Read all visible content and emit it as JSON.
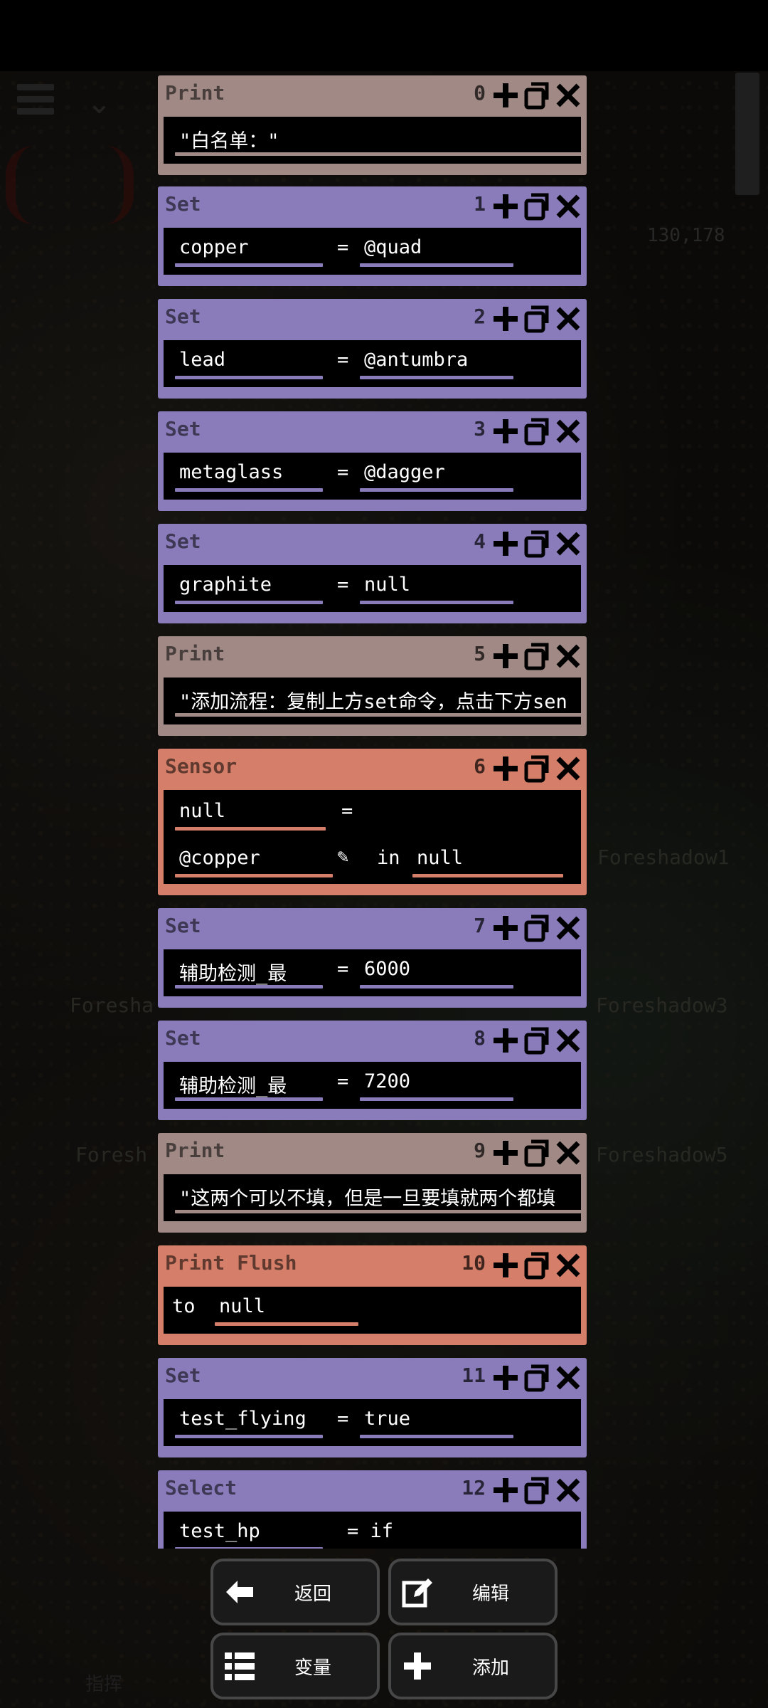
{
  "background": {
    "coordinates": "130,178",
    "labels": [
      "Foreshadow1",
      "Foreshadow3",
      "Foreshadow5",
      "Foresha",
      "Foresh"
    ],
    "command_label": "指挥"
  },
  "blocks": [
    {
      "type": "print",
      "title": "Print",
      "index": "0",
      "value": "\"白名单：\""
    },
    {
      "type": "set",
      "title": "Set",
      "index": "1",
      "var": "copper",
      "op": "=",
      "value": "@quad"
    },
    {
      "type": "set",
      "title": "Set",
      "index": "2",
      "var": "lead",
      "op": "=",
      "value": "@antumbra"
    },
    {
      "type": "set",
      "title": "Set",
      "index": "3",
      "var": "metaglass",
      "op": "=",
      "value": "@dagger"
    },
    {
      "type": "set",
      "title": "Set",
      "index": "4",
      "var": "graphite",
      "op": "=",
      "value": "null"
    },
    {
      "type": "print",
      "title": "Print",
      "index": "5",
      "value": "\"添加流程：复制上方set命令，点击下方sen"
    },
    {
      "type": "sensor",
      "title": "Sensor",
      "index": "6",
      "result": "null",
      "op": "=",
      "sensor": "@copper",
      "in_label": "in",
      "target": "null"
    },
    {
      "type": "set",
      "title": "Set",
      "index": "7",
      "var": "辅助检测_最",
      "op": "=",
      "value": "6000"
    },
    {
      "type": "set",
      "title": "Set",
      "index": "8",
      "var": "辅助检测_最",
      "op": "=",
      "value": "7200"
    },
    {
      "type": "print",
      "title": "Print",
      "index": "9",
      "value": "\"这两个可以不填，但是一旦要填就两个都填"
    },
    {
      "type": "flush",
      "title": "Print Flush",
      "index": "10",
      "to_label": "to",
      "target": "null"
    },
    {
      "type": "set",
      "title": "Set",
      "index": "11",
      "var": "test_flying",
      "op": "=",
      "value": "true"
    },
    {
      "type": "select",
      "title": "Select",
      "index": "12",
      "var": "test_hp",
      "op": "= if"
    }
  ],
  "bottom_buttons": {
    "back": "返回",
    "edit": "编辑",
    "variables": "变量",
    "add": "添加"
  },
  "colors": {
    "print": "#a18a86",
    "set": "#8a7cbb",
    "sensor": "#d57e69",
    "flush": "#d57e69"
  }
}
